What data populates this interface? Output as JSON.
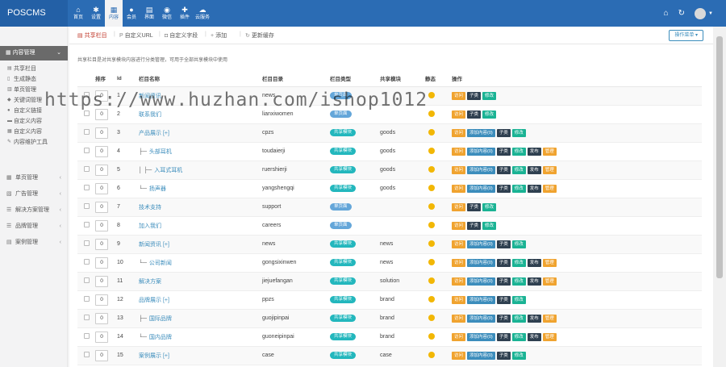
{
  "brand": "POSCMS",
  "topnav": [
    {
      "icon": "home-icon",
      "glyph": "⌂",
      "label": "首页"
    },
    {
      "icon": "gear-icon",
      "glyph": "✱",
      "label": "设置"
    },
    {
      "icon": "grid-icon",
      "glyph": "▦",
      "label": "内容"
    },
    {
      "icon": "user-icon",
      "glyph": "●",
      "label": "会员"
    },
    {
      "icon": "layout-icon",
      "glyph": "▤",
      "label": "界面"
    },
    {
      "icon": "wechat-icon",
      "glyph": "◉",
      "label": "微信"
    },
    {
      "icon": "plugin-icon",
      "glyph": "✚",
      "label": "插件"
    },
    {
      "icon": "cloud-icon",
      "glyph": "☁",
      "label": "云服务"
    }
  ],
  "topnav_active_index": 2,
  "sidebar": {
    "head": "内容管理",
    "items": [
      {
        "icon": "list-icon",
        "label": "共享栏目"
      },
      {
        "icon": "file-icon",
        "label": "生成静态"
      },
      {
        "icon": "pages-icon",
        "label": "单页管理"
      },
      {
        "icon": "tag-icon",
        "label": "关键词管理"
      },
      {
        "icon": "pin-icon",
        "label": "自定义链接"
      },
      {
        "icon": "link-icon",
        "label": "自定义内容"
      },
      {
        "icon": "block-icon",
        "label": "自定义内容"
      },
      {
        "icon": "wrench-icon",
        "label": "内容维护工具"
      }
    ],
    "menus": [
      {
        "icon": "module-icon",
        "label": "单页管理"
      },
      {
        "icon": "ad-icon",
        "label": "广告管理"
      },
      {
        "icon": "solution-icon",
        "label": "解决方案管理"
      },
      {
        "icon": "brand-icon",
        "label": "品牌管理"
      },
      {
        "icon": "case-icon",
        "label": "案例管理"
      }
    ]
  },
  "tabs": [
    {
      "icon": "list-icon",
      "label": "共享栏目"
    },
    {
      "icon": "custom-url-icon",
      "label": "自定义URL"
    },
    {
      "icon": "field-icon",
      "label": "自定义字段"
    },
    {
      "icon": "plus-icon",
      "label": "添加"
    },
    {
      "icon": "refresh-icon",
      "label": "更新缓存"
    }
  ],
  "op_button": "操作菜单 ▾",
  "tip": "共享栏目是对共享模块内容进行分类管理，可用于全部共享模块中使用",
  "table": {
    "headers": [
      "",
      "排序",
      "Id",
      "栏目名称",
      "栏目目录",
      "栏目类型",
      "共享模块",
      "静态",
      "操作"
    ],
    "rows": [
      {
        "order": "0",
        "id": "1",
        "tree": "",
        "name": "新闻资讯",
        "dir": "news",
        "type": "单页面",
        "type_kind": "single",
        "module": "",
        "actions": [
          "访问",
          "子类",
          "修改"
        ]
      },
      {
        "order": "0",
        "id": "2",
        "tree": "",
        "name": "联系我们",
        "dir": "lianxiwomen",
        "type": "单页面",
        "type_kind": "single",
        "module": "",
        "actions": [
          "访问",
          "子类",
          "修改"
        ]
      },
      {
        "order": "0",
        "id": "3",
        "tree": "",
        "name": "产品展示 [+]",
        "dir": "cpzs",
        "type": "共享模块",
        "type_kind": "share",
        "module": "goods",
        "actions": [
          "访问",
          "添加内容(0)",
          "子类",
          "修改"
        ]
      },
      {
        "order": "0",
        "id": "4",
        "tree": "├─",
        "name": "头部耳机",
        "dir": "toudaierji",
        "type": "共享模块",
        "type_kind": "share",
        "module": "goods",
        "actions": [
          "访问",
          "添加内容(0)",
          "子类",
          "修改",
          "发布",
          "管理"
        ]
      },
      {
        "order": "0",
        "id": "5",
        "tree": "│ ├─",
        "name": "入耳式耳机",
        "dir": "ruershierji",
        "type": "共享模块",
        "type_kind": "share",
        "module": "goods",
        "actions": [
          "访问",
          "添加内容(0)",
          "子类",
          "修改",
          "发布",
          "管理"
        ]
      },
      {
        "order": "0",
        "id": "6",
        "tree": "└─",
        "name": "扬声器",
        "dir": "yangshengqi",
        "type": "共享模块",
        "type_kind": "share",
        "module": "goods",
        "actions": [
          "访问",
          "添加内容(0)",
          "子类",
          "修改",
          "发布",
          "管理"
        ]
      },
      {
        "order": "0",
        "id": "7",
        "tree": "",
        "name": "技术支持",
        "dir": "support",
        "type": "单页面",
        "type_kind": "single",
        "module": "",
        "actions": [
          "访问",
          "子类",
          "修改"
        ]
      },
      {
        "order": "0",
        "id": "8",
        "tree": "",
        "name": "加入我们",
        "dir": "careers",
        "type": "单页面",
        "type_kind": "single",
        "module": "",
        "actions": [
          "访问",
          "子类",
          "修改"
        ]
      },
      {
        "order": "0",
        "id": "9",
        "tree": "",
        "name": "新闻资讯 [+]",
        "dir": "news",
        "type": "共享模块",
        "type_kind": "share",
        "module": "news",
        "actions": [
          "访问",
          "添加内容(0)",
          "子类",
          "修改"
        ]
      },
      {
        "order": "0",
        "id": "10",
        "tree": "└─",
        "name": "公司新闻",
        "dir": "gongsixinwen",
        "type": "共享模块",
        "type_kind": "share",
        "module": "news",
        "actions": [
          "访问",
          "添加内容(0)",
          "子类",
          "修改",
          "发布",
          "管理"
        ]
      },
      {
        "order": "0",
        "id": "11",
        "tree": "",
        "name": "解决方案",
        "dir": "jiejuefangan",
        "type": "共享模块",
        "type_kind": "share",
        "module": "solution",
        "actions": [
          "访问",
          "添加内容(0)",
          "子类",
          "修改",
          "发布",
          "管理"
        ]
      },
      {
        "order": "0",
        "id": "12",
        "tree": "",
        "name": "品牌展示 [+]",
        "dir": "ppzs",
        "type": "共享模块",
        "type_kind": "share",
        "module": "brand",
        "actions": [
          "访问",
          "添加内容(0)",
          "子类",
          "修改"
        ]
      },
      {
        "order": "0",
        "id": "13",
        "tree": "├─",
        "name": "国际品牌",
        "dir": "guojipinpai",
        "type": "共享模块",
        "type_kind": "share",
        "module": "brand",
        "actions": [
          "访问",
          "添加内容(0)",
          "子类",
          "修改",
          "发布",
          "管理"
        ]
      },
      {
        "order": "0",
        "id": "14",
        "tree": "└─",
        "name": "国内品牌",
        "dir": "guoneipinpai",
        "type": "共享模块",
        "type_kind": "share",
        "module": "brand",
        "actions": [
          "访问",
          "添加内容(0)",
          "子类",
          "修改",
          "发布",
          "管理"
        ]
      },
      {
        "order": "0",
        "id": "15",
        "tree": "",
        "name": "案例展示 [+]",
        "dir": "case",
        "type": "共享模块",
        "type_kind": "share",
        "module": "case",
        "actions": [
          "访问",
          "添加内容(0)",
          "子类",
          "修改"
        ]
      }
    ]
  },
  "watermark": "https://www.huzhan.com/ishop1012",
  "colors": {
    "topbar": "#2b6cb4",
    "accent_red": "#c0392b",
    "orange": "#f0a32f",
    "blue": "#3c8dbc",
    "dark": "#2f4050",
    "green": "#1ab394"
  }
}
